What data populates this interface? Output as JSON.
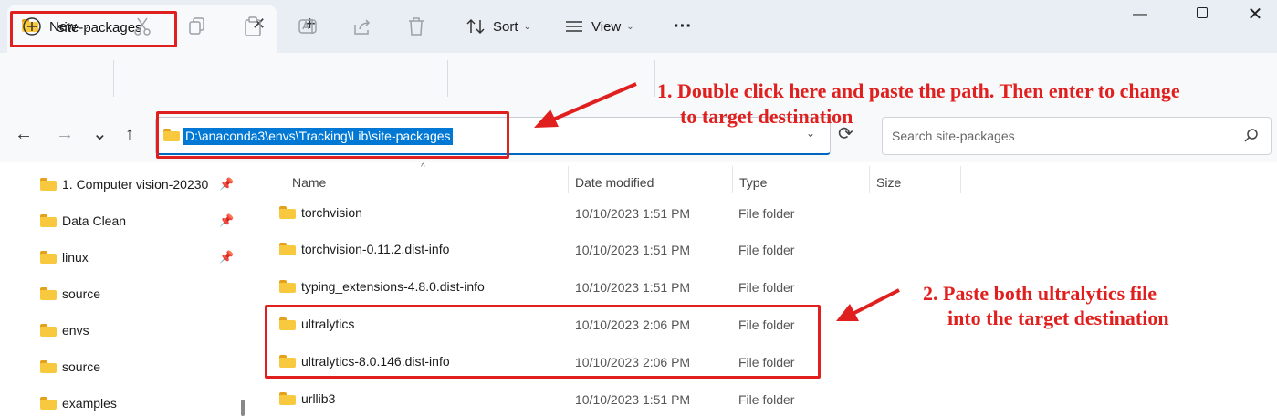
{
  "window": {
    "tab_title": "site-packages",
    "tab_close": "✕",
    "new_tab": "+",
    "controls": {
      "minimize": "—",
      "close": "✕"
    }
  },
  "toolbar": {
    "new_label": "New",
    "sort_label": "Sort",
    "view_label": "View",
    "more_label": "···"
  },
  "navigation": {
    "back": "←",
    "forward": "→",
    "recent": "⌄",
    "up": "↑"
  },
  "address": {
    "path": "D:\\anaconda3\\envs\\Tracking\\Lib\\site-packages",
    "refresh": "⟳"
  },
  "search": {
    "placeholder": "Search site-packages"
  },
  "sidebar": {
    "items": [
      {
        "label": "1. Computer vision-20230",
        "pinned": true
      },
      {
        "label": "Data Clean",
        "pinned": true
      },
      {
        "label": "linux",
        "pinned": true
      },
      {
        "label": "source",
        "pinned": false
      },
      {
        "label": "envs",
        "pinned": false
      },
      {
        "label": "source",
        "pinned": false
      },
      {
        "label": "examples",
        "pinned": false
      }
    ]
  },
  "columns": {
    "name": "Name",
    "date": "Date modified",
    "type": "Type",
    "size": "Size"
  },
  "files": [
    {
      "name": "torchvision",
      "date": "10/10/2023 1:51 PM",
      "type": "File folder"
    },
    {
      "name": "torchvision-0.11.2.dist-info",
      "date": "10/10/2023 1:51 PM",
      "type": "File folder"
    },
    {
      "name": "typing_extensions-4.8.0.dist-info",
      "date": "10/10/2023 1:51 PM",
      "type": "File folder"
    },
    {
      "name": "ultralytics",
      "date": "10/10/2023 2:06 PM",
      "type": "File folder"
    },
    {
      "name": "ultralytics-8.0.146.dist-info",
      "date": "10/10/2023 2:06 PM",
      "type": "File folder"
    },
    {
      "name": "urllib3",
      "date": "10/10/2023 1:51 PM",
      "type": "File folder"
    }
  ],
  "annotations": {
    "note1_line1": "1. Double click here and paste the path. Then enter to change",
    "note1_line2": "to target destination",
    "note2_line1": "2. Paste both ultralytics file",
    "note2_line2": "into the target destination",
    "color": "#e0201e"
  },
  "colors": {
    "accent": "#0078d4",
    "folder": "#f8c93e",
    "annotation": "#e0201e"
  }
}
